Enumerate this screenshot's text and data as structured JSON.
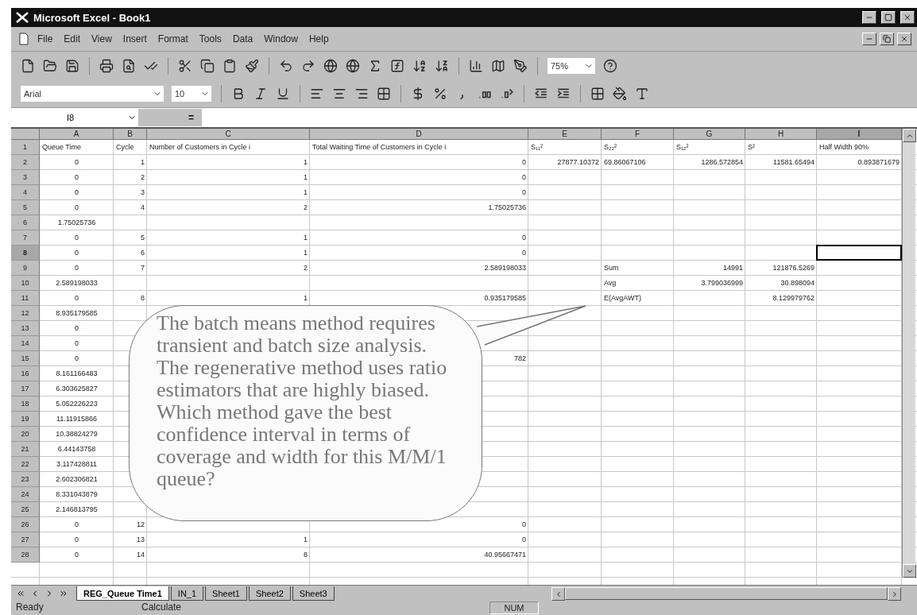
{
  "window": {
    "title": "Microsoft Excel - Book1"
  },
  "menu": [
    "File",
    "Edit",
    "View",
    "Insert",
    "Format",
    "Tools",
    "Data",
    "Window",
    "Help"
  ],
  "toolbar": {
    "zoom": "75%",
    "font": "Arial",
    "font_size": "10"
  },
  "formula_bar": {
    "name_box": "I8",
    "edit_formula": "="
  },
  "grid": {
    "columns": [
      {
        "label": "A",
        "selected": false
      },
      {
        "label": "B",
        "selected": false
      },
      {
        "label": "C",
        "selected": false
      },
      {
        "label": "D",
        "selected": false
      },
      {
        "label": "E",
        "selected": false
      },
      {
        "label": "F",
        "selected": false
      },
      {
        "label": "G",
        "selected": false
      },
      {
        "label": "H",
        "selected": false
      },
      {
        "label": "I",
        "selected": true
      }
    ],
    "rows": [
      {
        "label": "1",
        "selected": false,
        "cells": {
          "A": "Queue Time",
          "B": "Cycle",
          "C": "Number of Customers in Cycle i",
          "D": "Total Waiting Time of Customers in Cycle i",
          "E": "S₁₁²",
          "F": "S₂₂²",
          "G": "S₁₂²",
          "H": "S²",
          "I": "Half Width 90%"
        }
      },
      {
        "label": "2",
        "selected": false,
        "cells": {
          "A": "0",
          "B": "1",
          "C": "1",
          "D": "0",
          "E": "27877.10372",
          "F": "69.86067106",
          "G": "1286.572854",
          "H": "11581.65494",
          "I": "0.893871679"
        }
      },
      {
        "label": "3",
        "selected": false,
        "cells": {
          "A": "0",
          "B": "2",
          "C": "1",
          "D": "0"
        }
      },
      {
        "label": "4",
        "selected": false,
        "cells": {
          "A": "0",
          "B": "3",
          "C": "1",
          "D": "0"
        }
      },
      {
        "label": "5",
        "selected": false,
        "cells": {
          "A": "0",
          "B": "4",
          "C": "2",
          "D": "1.75025736"
        }
      },
      {
        "label": "6",
        "selected": false,
        "cells": {
          "A": "1.75025736"
        }
      },
      {
        "label": "7",
        "selected": false,
        "cells": {
          "A": "0",
          "B": "5",
          "C": "1",
          "D": "0"
        }
      },
      {
        "label": "8",
        "selected": true,
        "cells": {
          "A": "0",
          "B": "6",
          "C": "1",
          "D": "0"
        }
      },
      {
        "label": "9",
        "selected": false,
        "cells": {
          "A": "0",
          "B": "7",
          "C": "2",
          "D": "2.589198033",
          "F": "Sum",
          "G": "14991",
          "H": "121876.5269"
        }
      },
      {
        "label": "10",
        "selected": false,
        "cells": {
          "A": "2.589198033",
          "F": "Avg",
          "G": "3.799036999",
          "H": "30.898094"
        }
      },
      {
        "label": "11",
        "selected": false,
        "cells": {
          "A": "0",
          "B": "8",
          "C": "1",
          "D": "0.935179585",
          "F": "E(AvgAWT)",
          "H": "8.129979762"
        }
      },
      {
        "label": "12",
        "selected": false,
        "cells": {
          "A": "8.935179585"
        }
      },
      {
        "label": "13",
        "selected": false,
        "cells": {
          "A": "0"
        }
      },
      {
        "label": "14",
        "selected": false,
        "cells": {
          "A": "0"
        }
      },
      {
        "label": "15",
        "selected": false,
        "cells": {
          "A": "0",
          "D": "782"
        }
      },
      {
        "label": "16",
        "selected": false,
        "cells": {
          "A": "8.161166483"
        }
      },
      {
        "label": "17",
        "selected": false,
        "cells": {
          "A": "6.303625827"
        }
      },
      {
        "label": "18",
        "selected": false,
        "cells": {
          "A": "5.052226223"
        }
      },
      {
        "label": "19",
        "selected": false,
        "cells": {
          "A": "11.11915866"
        }
      },
      {
        "label": "20",
        "selected": false,
        "cells": {
          "A": "10.38824279"
        }
      },
      {
        "label": "21",
        "selected": false,
        "cells": {
          "A": "6.44143758"
        }
      },
      {
        "label": "22",
        "selected": false,
        "cells": {
          "A": "3.117428811"
        }
      },
      {
        "label": "23",
        "selected": false,
        "cells": {
          "A": "2.602306821"
        }
      },
      {
        "label": "24",
        "selected": false,
        "cells": {
          "A": "8.331043879"
        }
      },
      {
        "label": "25",
        "selected": false,
        "cells": {
          "A": "2.146813795"
        }
      },
      {
        "label": "26",
        "selected": false,
        "cells": {
          "A": "0",
          "B": "12",
          "D": "0"
        }
      },
      {
        "label": "27",
        "selected": false,
        "cells": {
          "A": "0",
          "B": "13",
          "C": "1",
          "D": "0"
        }
      },
      {
        "label": "28",
        "selected": false,
        "cells": {
          "A": "0",
          "B": "14",
          "C": "8",
          "D": "40.95667471"
        }
      }
    ]
  },
  "callout": {
    "text": "The batch means method requires transient and batch size analysis. The regenerative method uses ratio estimators that are highly biased. Which method gave the best confidence interval in terms of coverage and width for this M/M/1 queue?"
  },
  "sheet_tabs": [
    {
      "label": "REG_Queue Time1",
      "selected": true
    },
    {
      "label": "IN_1",
      "selected": false
    },
    {
      "label": "Sheet1",
      "selected": false
    },
    {
      "label": "Sheet2",
      "selected": false
    },
    {
      "label": "Sheet3",
      "selected": false
    }
  ],
  "status_bar": {
    "mode": "Ready",
    "message": "Calculate",
    "indicators": [
      "NUM"
    ]
  }
}
